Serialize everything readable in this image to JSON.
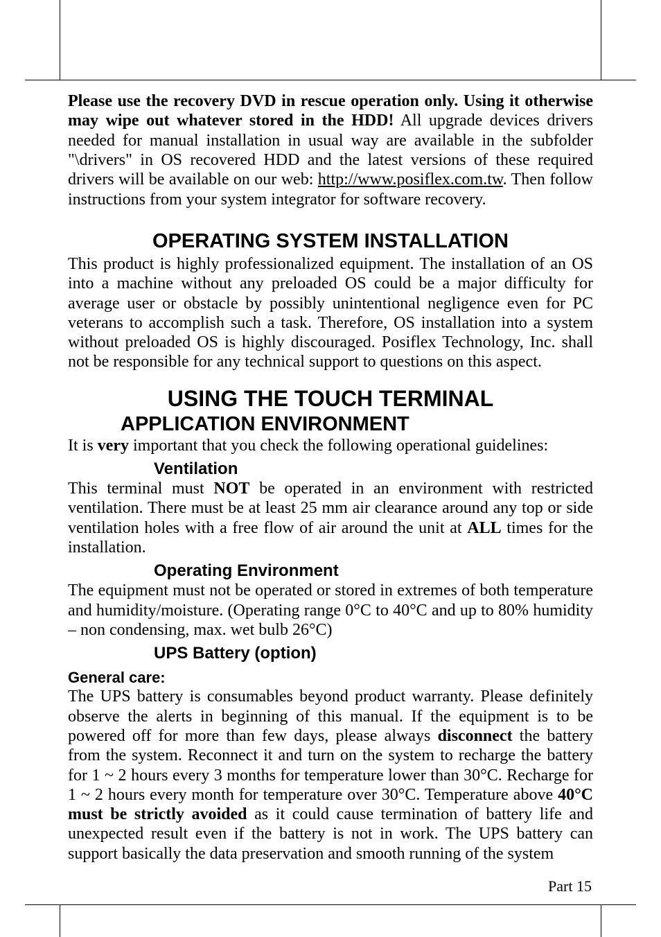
{
  "para1": {
    "lead_bold": "Please use the recovery DVD in rescue operation only. Using it otherwise may wipe out whatever stored in the HDD!",
    "rest_before_link": " All upgrade devices drivers needed for manual installation in usual way are available in the subfolder \"\\drivers\" in OS recovered HDD and the latest versions of these required drivers will be available on our web: ",
    "link": "http://www.posiflex.com.tw",
    "rest_after_link": ". Then follow instructions from your system integrator for software recovery."
  },
  "h2_os_install": "OPERATING SYSTEM INSTALLATION",
  "para_os_install": "This product is highly professionalized equipment. The installation of an OS into a machine without any preloaded OS could be a major difficulty for average user or obstacle by possibly unintentional negligence even for PC veterans to accomplish such a task. Therefore, OS installation into a system without preloaded OS is highly discouraged. Posiflex Technology, Inc. shall not be responsible for any technical support to questions on this aspect.",
  "h1_using": "USING THE TOUCH TERMINAL",
  "h2_app_env": "APPLICATION ENVIRONMENT",
  "para_app_env_intro_before": "It is ",
  "para_app_env_intro_bold": "very",
  "para_app_env_intro_after": " important that you check the following operational guidelines:",
  "h3_vent": "Ventilation",
  "para_vent": {
    "a": "This terminal must ",
    "b": "NOT",
    "c": " be operated in an environment with restricted ventilation. There must be at least 25 mm air clearance around any top or side ventilation holes with a free flow of air around the unit at ",
    "d": "ALL",
    "e": " times for the installation."
  },
  "h3_openv": "Operating Environment",
  "para_openv": "The equipment must not be operated or stored in extremes of both temperature and humidity/moisture. (Operating range 0°C to 40°C and up to 80% humidity – non condensing, max. wet bulb 26°C)",
  "h3_ups": "UPS Battery (option)",
  "h4_gen_care": "General care:",
  "para_ups": {
    "a": "The UPS battery is consumables beyond product warranty. Please definitely observe the alerts in beginning of this manual. If the equipment is to be powered off for more than few days, please always ",
    "b": "disconnect",
    "c": " the battery from the system. Reconnect it and turn on the system to recharge the battery for 1 ~ 2 hours every 3 months for temperature lower than 30°C. Recharge for 1 ~ 2 hours every month for temperature over 30°C. Temperature above ",
    "d": "40°C must be strictly avoided",
    "e": " as it could cause termination of battery life and unexpected result even if the battery is not in work. The UPS battery can support basically the data preservation and smooth running of the system"
  },
  "footer": "Part 15"
}
